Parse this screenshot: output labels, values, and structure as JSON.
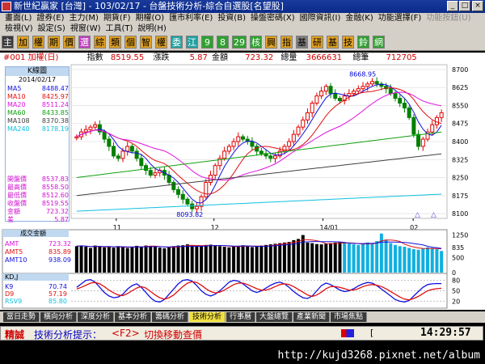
{
  "window": {
    "title": "新世紀贏家 [台灣] - 103/02/17 - 台盤技術分析-綜合自選股[名望股]",
    "buttons": [
      "_",
      "□",
      "×"
    ]
  },
  "menu": {
    "row1": [
      {
        "label": "畫面(L)",
        "enabled": true
      },
      {
        "label": "證券(E)",
        "enabled": true
      },
      {
        "label": "主力(M)",
        "enabled": true
      },
      {
        "label": "期貨(F)",
        "enabled": true
      },
      {
        "label": "期權(O)",
        "enabled": true
      },
      {
        "label": "匯市利率(E)",
        "enabled": true
      },
      {
        "label": "投資(B)",
        "enabled": true
      },
      {
        "label": "操盤密碼(X)",
        "enabled": true
      },
      {
        "label": "國際資訊(I)",
        "enabled": true
      },
      {
        "label": "金融(K)",
        "enabled": true
      },
      {
        "label": "功能選擇(F)",
        "enabled": true
      },
      {
        "label": "功能按鈕(U)",
        "enabled": false
      }
    ],
    "row2": [
      {
        "label": "檢視(V)",
        "enabled": true
      },
      {
        "label": "設定(S)",
        "enabled": true
      },
      {
        "label": "視窗(W)",
        "enabled": true
      },
      {
        "label": "工具(T)",
        "enabled": true
      },
      {
        "label": "說明(H)",
        "enabled": true
      }
    ]
  },
  "toolbar": {
    "buttons": [
      {
        "label": "主",
        "bg": "#3a3a3a",
        "fg": "#ffffff"
      },
      {
        "label": "加",
        "bg": "#e0a020",
        "fg": "#000000"
      },
      {
        "label": "權",
        "bg": "#e0a020",
        "fg": "#000000"
      },
      {
        "label": "期",
        "bg": "#e0a020",
        "fg": "#000000"
      },
      {
        "label": "價",
        "bg": "#e0a020",
        "fg": "#000000"
      },
      {
        "label": "選",
        "bg": "#c040c0",
        "fg": "#ffffff"
      },
      {
        "label": "綜",
        "bg": "#e0a020",
        "fg": "#000000"
      },
      {
        "label": "類",
        "bg": "#e0a020",
        "fg": "#000000"
      },
      {
        "label": "個",
        "bg": "#e0a020",
        "fg": "#000000"
      },
      {
        "label": "智",
        "bg": "#e0a020",
        "fg": "#000000"
      },
      {
        "label": "權",
        "bg": "#e0a020",
        "fg": "#000000"
      },
      {
        "label": "委",
        "bg": "#20a0a0",
        "fg": "#ffffff"
      },
      {
        "label": "江",
        "bg": "#20a0a0",
        "fg": "#ffffff"
      },
      {
        "label": "9",
        "bg": "#30a030",
        "fg": "#ffffff"
      },
      {
        "label": "8",
        "bg": "#30a030",
        "fg": "#ffffff"
      },
      {
        "label": "29",
        "bg": "#30a030",
        "fg": "#ffffff"
      },
      {
        "label": "核",
        "bg": "#30a030",
        "fg": "#ffffff"
      },
      {
        "label": "興",
        "bg": "#e0a020",
        "fg": "#000000"
      },
      {
        "label": "指",
        "bg": "#e0a020",
        "fg": "#000000"
      },
      {
        "label": "基",
        "bg": "#808080",
        "fg": "#000000"
      },
      {
        "label": "研",
        "bg": "#e0a020",
        "fg": "#000000"
      },
      {
        "label": "基",
        "bg": "#e0a020",
        "fg": "#000000"
      },
      {
        "label": "技",
        "bg": "#e0a020",
        "fg": "#000000"
      },
      {
        "label": "鈴",
        "bg": "#30a030",
        "fg": "#ffffff"
      },
      {
        "label": "網",
        "bg": "#30a030",
        "fg": "#ffffff"
      }
    ]
  },
  "info": {
    "stock": "#001 加權(日)",
    "index_label": "指數",
    "index_value": "8519.55",
    "change_label": "漲跌",
    "change_value": "5.87",
    "amount_label": "金額",
    "amount_value": "723.32",
    "volume_label": "總量",
    "volume_value": "3666631",
    "total_label": "總筆",
    "total_value": "712705"
  },
  "legend": {
    "title": "K線圖",
    "date": "2014/02/17",
    "ma": [
      {
        "label": "MA5",
        "value": "8488.47",
        "color": "#1010e0"
      },
      {
        "label": "MA10",
        "value": "8425.97",
        "color": "#e01010"
      },
      {
        "label": "MA20",
        "value": "8511.24",
        "color": "#e010e0"
      },
      {
        "label": "MA60",
        "value": "8433.85",
        "color": "#10a010"
      },
      {
        "label": "MA108",
        "value": "8370.38",
        "color": "#404040"
      },
      {
        "label": "MA240",
        "value": "8178.19",
        "color": "#10c0e0"
      }
    ],
    "ohlc": [
      {
        "label": "開盤價",
        "value": "8537.83"
      },
      {
        "label": "最高價",
        "value": "8558.50"
      },
      {
        "label": "最低價",
        "value": "8512.60"
      },
      {
        "label": "收盤價",
        "value": "8519.55"
      },
      {
        "label": "金額",
        "value": "723.32"
      },
      {
        "label": "差",
        "value": "5.87"
      }
    ]
  },
  "chart_data": [
    {
      "type": "candlestick",
      "title": "K線圖",
      "yticks": [
        "8700",
        "8625",
        "8550",
        "8475",
        "8400",
        "8325",
        "8250",
        "8175",
        "8100"
      ],
      "ylim": [
        8080,
        8720
      ],
      "xticks": [
        "11",
        "12",
        "14/01",
        "02"
      ],
      "annotations": [
        "8668.95",
        "8093.82"
      ],
      "series": [
        {
          "name": "MA5",
          "color": "#1010e0"
        },
        {
          "name": "MA10",
          "color": "#e01010"
        },
        {
          "name": "MA20",
          "color": "#e010e0"
        },
        {
          "name": "MA60",
          "color": "#10a010"
        },
        {
          "name": "MA108",
          "color": "#404040"
        },
        {
          "name": "MA240",
          "color": "#10c0e0"
        }
      ],
      "closes": [
        8420,
        8440,
        8450,
        8460,
        8470,
        8440,
        8410,
        8380,
        8340,
        8330,
        8360,
        8380,
        8360,
        8330,
        8300,
        8280,
        8260,
        8270,
        8280,
        8260,
        8230,
        8200,
        8180,
        8160,
        8140,
        8120,
        8130,
        8170,
        8230,
        8260,
        8300,
        8330,
        8360,
        8380,
        8400,
        8420,
        8410,
        8400,
        8380,
        8360,
        8350,
        8340,
        8330,
        8340,
        8360,
        8380,
        8400,
        8430,
        8460,
        8490,
        8520,
        8560,
        8590,
        8610,
        8630,
        8600,
        8580,
        8570,
        8590,
        8600,
        8610,
        8620,
        8630,
        8640,
        8650,
        8640,
        8630,
        8620,
        8600,
        8580,
        8560,
        8540,
        8500,
        8430,
        8380,
        8410,
        8440,
        8470,
        8500,
        8520
      ],
      "highlighted_lows": [],
      "bottom_marks": [
        "△",
        "△"
      ]
    },
    {
      "type": "bar",
      "title": "成交金額",
      "yticks": [
        "1250",
        "835",
        "500",
        "0"
      ],
      "ylim": [
        0,
        1400
      ],
      "series": [
        {
          "name": "AMT",
          "value": "723.32",
          "color": "#e010e0"
        },
        {
          "name": "AMT5",
          "value": "835.89",
          "color": "#e01010"
        },
        {
          "name": "AMT10",
          "value": "938.09",
          "color": "#1010e0"
        }
      ],
      "values": [
        880,
        900,
        860,
        820,
        900,
        870,
        840,
        860,
        830,
        880,
        850,
        820,
        860,
        890,
        870,
        900,
        880,
        860,
        830,
        810,
        850,
        880,
        900,
        910,
        940,
        900,
        860,
        880,
        920,
        930,
        900,
        880,
        860,
        840,
        870,
        890,
        910,
        880,
        850,
        870,
        900,
        920,
        940,
        960,
        980,
        1000,
        1020,
        1080,
        1120,
        1250,
        1000,
        980,
        950,
        940,
        960,
        980,
        1000,
        1020,
        990,
        960,
        940,
        920,
        960,
        1000,
        980,
        1050,
        1300,
        1100,
        980,
        920,
        880,
        860,
        820,
        780,
        760,
        800,
        840,
        820,
        780,
        720
      ]
    },
    {
      "type": "line",
      "title": "KD,J",
      "yticks": [
        "80",
        "50",
        "20"
      ],
      "ylim": [
        0,
        100
      ],
      "series": [
        {
          "name": "K9",
          "value": "70.74",
          "color": "#1010e0"
        },
        {
          "name": "D9",
          "value": "57.19",
          "color": "#e01010"
        },
        {
          "name": "RSV9",
          "value": "85.80",
          "color": "#10c0e0"
        }
      ],
      "k": [
        60,
        70,
        80,
        82,
        75,
        60,
        45,
        35,
        30,
        32,
        40,
        55,
        65,
        70,
        60,
        45,
        30,
        20,
        18,
        25,
        40,
        55,
        70,
        80,
        82,
        78,
        65,
        50,
        40,
        35,
        40,
        50,
        62,
        75,
        80,
        78,
        70,
        60,
        50,
        45,
        50,
        58,
        66,
        72,
        75,
        70,
        60,
        48,
        38,
        30,
        28,
        35,
        50,
        65,
        72,
        68,
        60,
        52,
        48,
        50,
        56,
        64,
        70,
        74,
        72,
        65,
        55,
        45,
        35,
        25,
        20,
        18,
        22,
        35,
        48,
        60,
        68,
        70,
        71,
        70.74
      ],
      "d": [
        55,
        60,
        66,
        72,
        74,
        70,
        62,
        52,
        44,
        38,
        36,
        42,
        50,
        58,
        62,
        58,
        48,
        38,
        30,
        26,
        30,
        38,
        50,
        62,
        72,
        76,
        74,
        66,
        56,
        48,
        44,
        46,
        52,
        60,
        68,
        72,
        72,
        68,
        62,
        56,
        52,
        52,
        56,
        62,
        68,
        70,
        68,
        62,
        54,
        46,
        38,
        34,
        38,
        46,
        56,
        62,
        62,
        60,
        56,
        52,
        52,
        56,
        62,
        66,
        68,
        66,
        62,
        56,
        48,
        40,
        32,
        26,
        24,
        28,
        34,
        42,
        50,
        54,
        56,
        57.19
      ]
    }
  ],
  "tabs": [
    {
      "label": "當日走勢",
      "active": false
    },
    {
      "label": "橫向分析",
      "active": false
    },
    {
      "label": "深度分析",
      "active": false
    },
    {
      "label": "基本分析",
      "active": false
    },
    {
      "label": "籌碼分析",
      "active": false
    },
    {
      "label": "技術分析",
      "active": true
    },
    {
      "label": "行事曆",
      "active": false
    },
    {
      "label": "大盤總覽",
      "active": false
    },
    {
      "label": "產業新聞",
      "active": false
    },
    {
      "label": "市場焦點",
      "active": false
    }
  ],
  "status": {
    "label": "精誠",
    "hint": "技術分析提示：",
    "key": "<F2>",
    "action": "切換移動查價",
    "time": "14:29:57"
  },
  "watermark": "http://kujd3268.pixnet.net/album"
}
